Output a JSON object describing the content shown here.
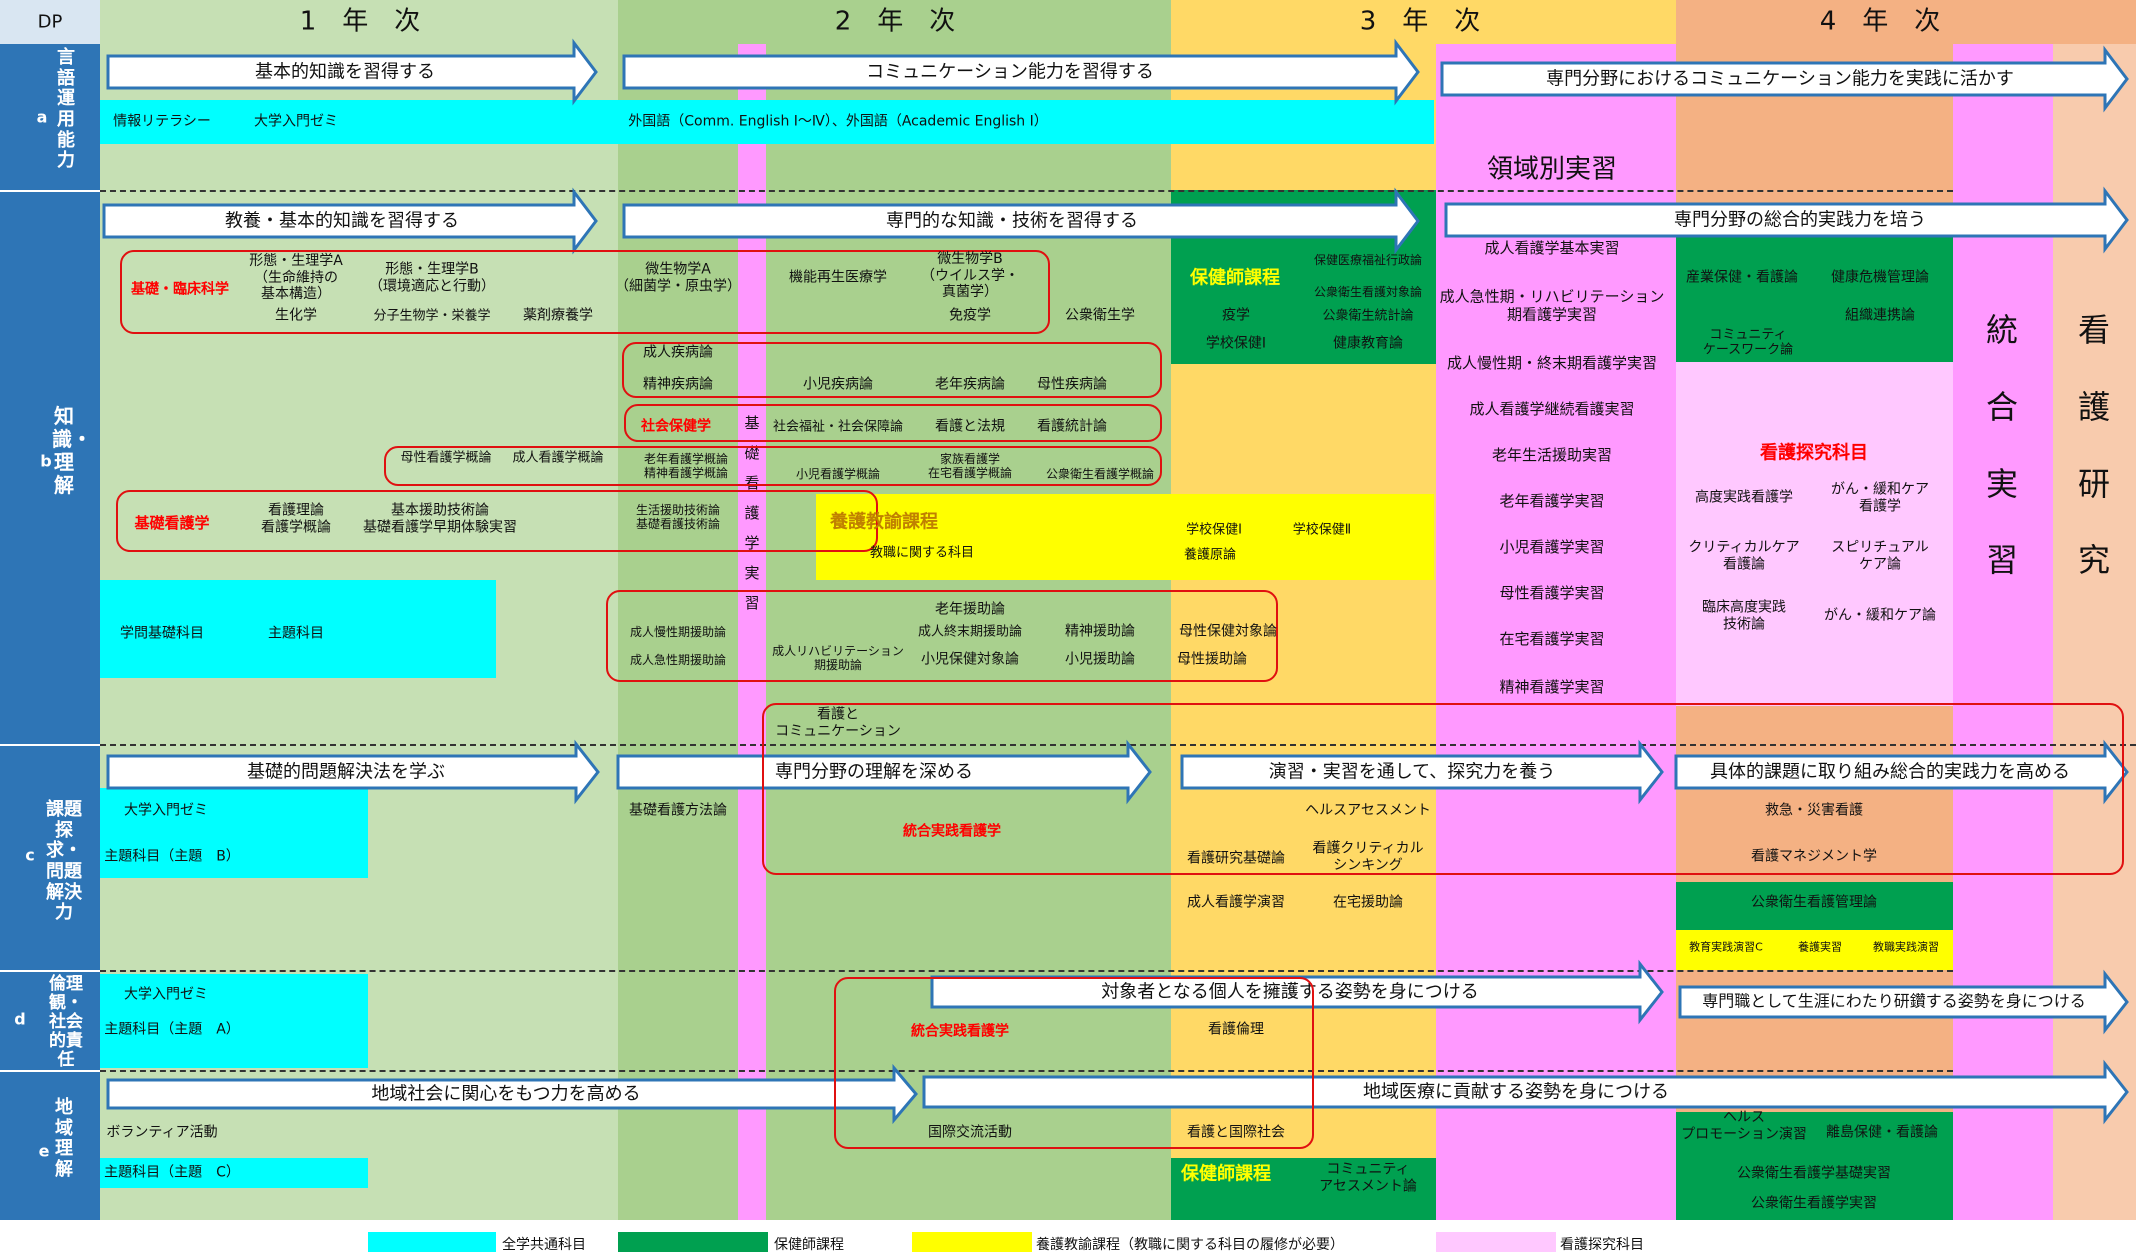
{
  "header": {
    "dp": "DP",
    "years": [
      "1　年　次",
      "2　年　次",
      "3　年　次",
      "4　年　次"
    ]
  },
  "dp_labels": {
    "a": "言語運用能力",
    "a_sub": "a",
    "b": "知識・理解",
    "b_sub": "b",
    "c": "課題探求・問題解決力",
    "c_sub": "c",
    "d": "倫理観・社会的責任",
    "d_sub": "d",
    "e": "地域理解",
    "e_sub": "e"
  },
  "arrows": {
    "a1": "基本的知識を習得する",
    "a2": "コミュニケーション能力を習得する",
    "a3": "専門分野におけるコミュニケーション能力を実践に活かす",
    "b1": "教養・基本的知識を習得する",
    "b2": "専門的な知識・技術を習得する",
    "b3": "専門分野の総合的実践力を培う",
    "c1": "基礎的問題解決法を学ぶ",
    "c2": "専門分野の理解を深める",
    "c3": "演習・実習を通して、探究力を養う",
    "c4": "具体的課題に取り組み総合的実践力を高める",
    "d1": "対象者となる個人を擁護する姿勢を身につける",
    "d2": "専門職として生涯にわたり研鑽する姿勢を身につける",
    "e1": "地域社会に関心をもつ力を高める",
    "e2": "地域医療に貢献する姿勢を身につける"
  },
  "row_a": {
    "c1": "情報リテラシー",
    "c2": "大学入門ゼミ",
    "c3": "外国語（Comm. English Ⅰ～Ⅳ）、外国語（Academic English Ⅰ）",
    "ryoiki": "領域別実習"
  },
  "vertical": {
    "kiso_jisshu": "基礎看護学実習",
    "togo_jisshu": "統合実習",
    "kango_kenkyu": "看護研究"
  },
  "year1_b": {
    "group1_label": "基礎・臨床科学",
    "keitai_a": "形態・生理学A\n（生命維持の\n基本構造）",
    "keitai_b": "形態・生理学B\n（環境適応と行動）",
    "seika": "生化学",
    "bunshi": "分子生物学・栄養学",
    "yakuzai": "薬剤療養学",
    "bosei_gairon": "母性看護学概論",
    "seijin_gairon": "成人看護学概論",
    "kiso_label": "基礎看護学",
    "kango_riron": "看護理論\n看護学概論",
    "kihon_enjo": "基本援助技術論\n基礎看護学早期体験実習",
    "gakumon": "学問基礎科目",
    "shudai": "主題科目"
  },
  "year2_b": {
    "biseibutsu_a": "微生物学A\n（細菌学・原虫学）",
    "kino_saisei": "機能再生医療学",
    "biseibutsu_b": "微生物学B\n（ウイルス学・\n真菌学）",
    "meneki": "免疫学",
    "kousyu_eisei": "公衆衛生学",
    "seijin_shippei": "成人疾病論",
    "seishin_shippei": "精神疾病論",
    "shoni_shippei": "小児疾病論",
    "ronen_shippei": "老年疾病論",
    "bosei_shippei": "母性疾病論",
    "shakai_label": "社会保健学",
    "shakai_fukushi": "社会福祉・社会保障論",
    "kango_to_ho": "看護と法規",
    "kango_tokei": "看護統計論",
    "ronen_gairon": "老年看護学概論\n精神看護学概論",
    "shoni_gairon": "小児看護学概論",
    "kazoku_gairon": "家族看護学\n在宅看護学概論",
    "kosyu_gairon": "公衆衛生看護学概論",
    "seikatsu": "生活援助技術論\n基礎看護技術論",
    "seijin_mansei": "成人慢性期援助論",
    "seijin_kyusei": "成人急性期援助論",
    "seijin_rehab": "成人リハビリテーション\n期援助論",
    "ronen_enjo": "老年援助論",
    "seijin_shumatsu": "成人終末期援助論",
    "shoni_hoken": "小児保健対象論",
    "seishin_enjo": "精神援助論",
    "shoni_enjo": "小児援助論",
    "bosei_taisho": "母性保健対象論",
    "bosei_enjo": "母性援助論",
    "kango_comm": "看護と\nコミュニケーション"
  },
  "yogo": {
    "title": "養護教諭課程",
    "sub": "教職に関する科目",
    "gakko1": "学校保健Ⅰ",
    "gakko2": "学校保健Ⅱ",
    "yogo_genri": "養護原論"
  },
  "hokenshi": {
    "title": "保健師課程",
    "hokeniryo": "保健医療福祉行政論",
    "kosyu_taisho": "公衆衛生看護対象論",
    "kosyu_tokei": "公衆衛生統計論",
    "ekigaku": "疫学",
    "gakko_hoken": "学校保健Ⅰ",
    "kenko_kyoiku": "健康教育論",
    "title2": "保健師課程",
    "community": "コミュニティ\nアセスメント論"
  },
  "year3_jisshu": [
    "成人看護学基本実習",
    "成人急性期・リハビリテーション\n期看護学実習",
    "成人慢性期・終末期看護学実習",
    "成人看護学継続看護実習",
    "老年生活援助実習",
    "老年看護学実習",
    "小児看護学実習",
    "母性看護学実習",
    "在宅看護学実習",
    "精神看護学実習"
  ],
  "year4_b": {
    "sangyo": "産業保健・看護論",
    "kenko_kiki": "健康危機管理論",
    "soshiki": "組織連携論",
    "community_case": "コミュニティ\nケースワーク論",
    "tankyu_label": "看護探究科目",
    "kodo_jissen": "高度実践看護学",
    "gan_kanwa_care": "がん・緩和ケア\n看護学",
    "critical": "クリティカルケア\n看護論",
    "spiritual": "スピリチュアル\nケア論",
    "rinsho_kodo": "臨床高度実践\n技術論",
    "gan_kanwa_ron": "がん・緩和ケア論"
  },
  "row_c": {
    "daigaku_zemi": "大学入門ゼミ",
    "shudai_b": "主題科目（主題　B）",
    "kiso_hoho": "基礎看護方法論",
    "togo_label": "統合実践看護学",
    "health_assess": "ヘルスアセスメント",
    "kenkyu_kiso": "看護研究基礎論",
    "kango_critical": "看護クリティカル\nシンキング",
    "seijin_enshu": "成人看護学演習",
    "zaitaku_enjo": "在宅援助論",
    "kyukyu": "救急・災害看護",
    "management": "看護マネジメント学",
    "kosyu_kanri": "公衆衛生看護管理論",
    "kyoiku_jissen": "教育実践演習C",
    "yogo_jisshu": "養護実習",
    "kyoshoku_jisshu": "教職実践演習"
  },
  "row_d": {
    "daigaku_zemi": "大学入門ゼミ",
    "shudai_a": "主題科目（主題　A）",
    "togo_label": "統合実践看護学",
    "kango_rinri": "看護倫理"
  },
  "row_e": {
    "volunteer": "ボランティア活動",
    "shudai_c": "主題科目（主題　C）",
    "kokusai": "国際交流活動",
    "kango_kokusai": "看護と国際社会",
    "health_promo": "ヘルス\nプロモーション演習",
    "rito": "離島保健・看護論",
    "kosyu_kiso_jisshu": "公衆衛生看護学基礎実習",
    "kosyu_jisshu": "公衆衛生看護学実習"
  },
  "legend": [
    {
      "label": "全学共通科目",
      "color": "#00ffff"
    },
    {
      "label": "保健師課程",
      "color": "#00a050"
    },
    {
      "label": "養護教諭課程（教職に関する科目の履修が必要）",
      "color": "#ffff00"
    },
    {
      "label": "看護探究科目",
      "color": "#ffc8ff"
    }
  ],
  "colors": {
    "dp_blue": "#2e75b6",
    "year1": "#c6e0b4",
    "year2": "#a9d08e",
    "year3": "#ffd966",
    "year4": "#f4b183",
    "magenta": "#ff99ff",
    "peach": "#f8cbad",
    "red_label": "#ff0000"
  }
}
